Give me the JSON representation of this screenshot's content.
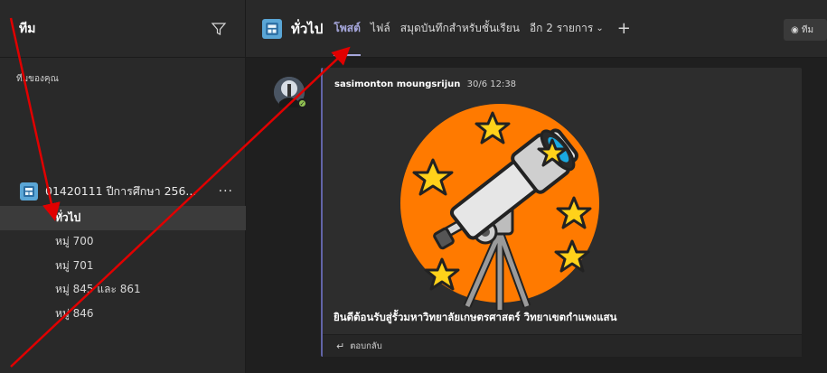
{
  "sidebar": {
    "title": "ทีม",
    "filter_icon": "filter-icon",
    "section_label": "ทีมของคุณ",
    "team": {
      "name": "01420111 ปีการศึกษา 256...",
      "more": "···",
      "channels": [
        {
          "label": "ทั่วไป",
          "active": true
        },
        {
          "label": "หมู่ 700",
          "active": false
        },
        {
          "label": "หมู่ 701",
          "active": false
        },
        {
          "label": "หมู่ 845 และ 861",
          "active": false
        },
        {
          "label": "หมู่ 846",
          "active": false
        }
      ]
    }
  },
  "header": {
    "channel_title": "ทั่วไป",
    "tabs": [
      {
        "label": "โพสต์",
        "active": true
      },
      {
        "label": "ไฟล์",
        "active": false
      },
      {
        "label": "สมุดบันทึกสำหรับชั้นเรียน",
        "active": false
      },
      {
        "label": "อีก 2 รายการ",
        "active": false
      }
    ],
    "add_tab": "+",
    "meet_label": "ทีม"
  },
  "post": {
    "author": "sasimonton moungsrijun",
    "time": "30/6 12:38",
    "message": "ยินดีต้อนรับสู่รั้วมหาวิทยาลัยเกษตรศาสตร์ วิทยาเขตกำแพงแสน",
    "reply_label": "ตอบกลับ",
    "illustration": "telescope-with-stars"
  },
  "colors": {
    "accent": "#a6a7dc",
    "team_icon": "#5aa6d6",
    "presence": "#92c353",
    "annotation_arrow": "#e00000",
    "illustration_orange": "#ff7a00"
  }
}
